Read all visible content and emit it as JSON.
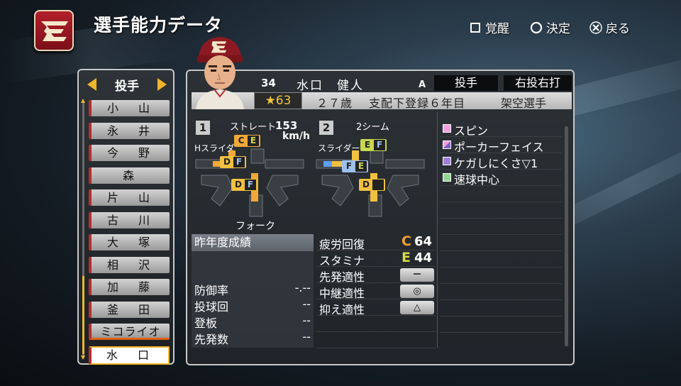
{
  "header": {
    "title": "選手能力データ",
    "hints": [
      {
        "icon": "square-button-icon",
        "label": "覚醒"
      },
      {
        "icon": "circle-button-icon",
        "label": "決定"
      },
      {
        "icon": "cross-button-icon",
        "label": "戻る"
      }
    ]
  },
  "roster": {
    "position": "投手",
    "players": [
      "小　山",
      "永　井",
      "今　野",
      "森",
      "片　山",
      "古　川",
      "大　塚",
      "相　沢",
      "加　藤",
      "釜　田",
      "ミコライオ",
      "水　口"
    ],
    "selected_index": 11
  },
  "player": {
    "number": "34",
    "name": "水口　健人",
    "rank": "A",
    "role": "投手",
    "throw_bat": "右投右打",
    "overall": "★63",
    "age": "２７歳",
    "registration": "支配下登録６年目",
    "status": "架空選手"
  },
  "pitches": {
    "slot1": "1",
    "slot2": "2",
    "straight_label": "ストレート",
    "speed": "153",
    "speed_unit": "km/h",
    "left_side_label": "Hスライダ",
    "fork_label": "フォーク",
    "two_seam_label": "2シーム",
    "slider_label": "スライダー",
    "grades": {
      "h_slider_top": [
        "C",
        "E"
      ],
      "h_slider_mid": [
        "D",
        "F"
      ],
      "fork": [
        "D",
        "F"
      ],
      "two_seam": [
        "E",
        "F"
      ],
      "slider": [
        "F",
        "E"
      ],
      "sinker": [
        "D",
        ""
      ]
    }
  },
  "last_season": {
    "header": "昨年度成績",
    "rows": [
      {
        "label": "防御率",
        "value": "-.--"
      },
      {
        "label": "投球回",
        "value": "--"
      },
      {
        "label": "登板",
        "value": "--"
      },
      {
        "label": "先発数",
        "value": "--"
      }
    ]
  },
  "basics": [
    {
      "label": "疲労回復",
      "grade": "C",
      "value": "64",
      "color": "#f0a030"
    },
    {
      "label": "スタミナ",
      "grade": "E",
      "value": "44",
      "color": "#d4d84a"
    },
    {
      "label": "先発適性",
      "badge": "－"
    },
    {
      "label": "中継適性",
      "badge": "◎"
    },
    {
      "label": "抑え適性",
      "badge": "△"
    }
  ],
  "abilities": [
    {
      "text": "スピン",
      "color": "#f2a0e0"
    },
    {
      "text": "ポーカーフェイス",
      "color": "#c890e8"
    },
    {
      "text": "ケガしにくさ▽1",
      "color": "#a080d8"
    },
    {
      "text": "速球中心",
      "color": "#90d890"
    }
  ],
  "colors": {
    "accent": "#f0b52a",
    "grade_C": "#f0a030",
    "grade_D": "#f0c040",
    "grade_E": "#c8d850",
    "grade_F": "#9ec0f0"
  }
}
